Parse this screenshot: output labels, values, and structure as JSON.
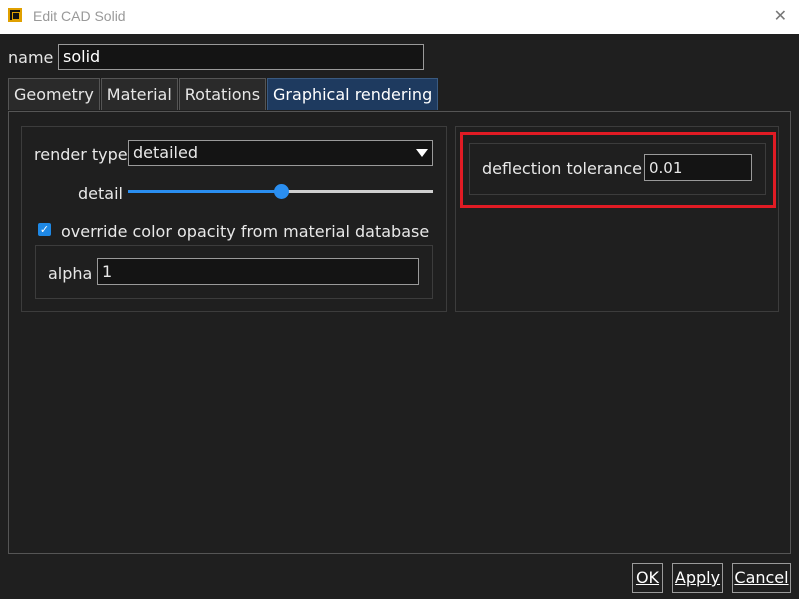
{
  "window": {
    "title": "Edit CAD Solid",
    "close_glyph": "✕"
  },
  "name_field": {
    "label": "name",
    "value": "solid"
  },
  "tabs": [
    {
      "label": "Geometry"
    },
    {
      "label": "Material"
    },
    {
      "label": "Rotations"
    },
    {
      "label": "Graphical rendering",
      "active": true
    }
  ],
  "rendering": {
    "render_type_label": "render type",
    "render_type_value": "detailed",
    "detail_label": "detail",
    "detail_fraction": 0.5,
    "override_checked": true,
    "override_label": "override color opacity from material database",
    "alpha_label": "alpha",
    "alpha_value": "1",
    "deflection_label": "deflection tolerance",
    "deflection_value": "0.01"
  },
  "buttons": {
    "ok": "OK",
    "apply": "Apply",
    "cancel": "Cancel"
  },
  "colors": {
    "accent": "#2a8ef0",
    "active_tab": "#1e3a5f",
    "highlight": "#e01b24",
    "app_icon": "#e0a000"
  }
}
